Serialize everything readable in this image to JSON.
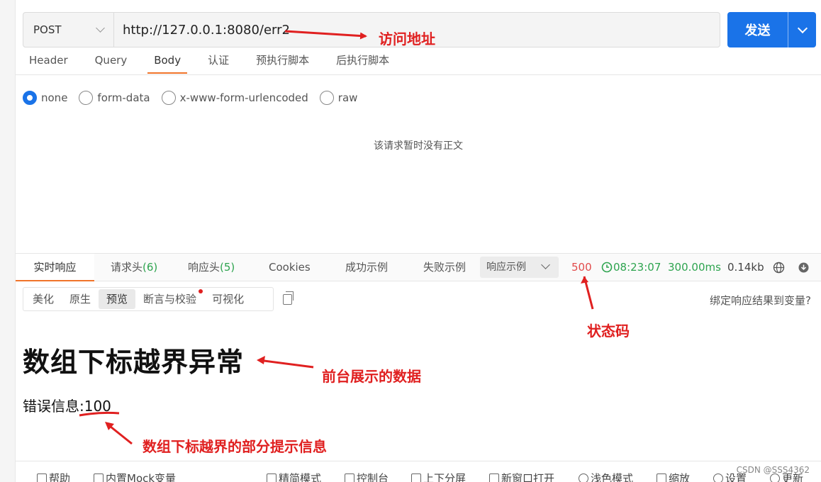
{
  "request": {
    "method": "POST",
    "url": "http://127.0.0.1:8080/err2",
    "send_label": "发送",
    "tabs": [
      "Header",
      "Query",
      "Body",
      "认证",
      "预执行脚本",
      "后执行脚本"
    ],
    "active_tab": "Body",
    "body_types": [
      "none",
      "form-data",
      "x-www-form-urlencoded",
      "raw"
    ],
    "selected_body_type": "none",
    "empty_message": "该请求暂时没有正文"
  },
  "response": {
    "tabs": {
      "realtime": "实时响应",
      "req_headers": "请求头",
      "req_headers_count": "(6)",
      "resp_headers": "响应头",
      "resp_headers_count": "(5)",
      "cookies": "Cookies",
      "success_example": "成功示例",
      "fail_example": "失败示例"
    },
    "example_select": "响应示例",
    "status_code": "500",
    "time": "08:23:07",
    "duration": "300.00ms",
    "size": "0.14kb",
    "view_modes": [
      "美化",
      "原生",
      "预览",
      "断言与校验",
      "可视化"
    ],
    "active_view": "预览",
    "bind_link": "绑定响应结果到变量?",
    "preview": {
      "heading": "数组下标越界异常",
      "paragraph": "错误信息:100"
    }
  },
  "annotations": {
    "url": "访问地址",
    "status": "状态码",
    "frontend": "前台展示的数据",
    "detail": "数组下标越界的部分提示信息"
  },
  "footer": {
    "help": "帮助",
    "mock": "内置Mock变量",
    "simple_mode": "精简模式",
    "console": "控制台",
    "split": "上下分屏",
    "new_window": "新窗口打开",
    "light_mode": "浅色模式",
    "zoom": "缩放",
    "settings": "设置",
    "update": "更新"
  },
  "watermark": "CSDN @SSS4362",
  "colors": {
    "primary": "#1a73e8",
    "accent": "#f0742a",
    "status_error": "#e24b4b",
    "success": "#2ea44f",
    "annotation": "#e02020"
  }
}
